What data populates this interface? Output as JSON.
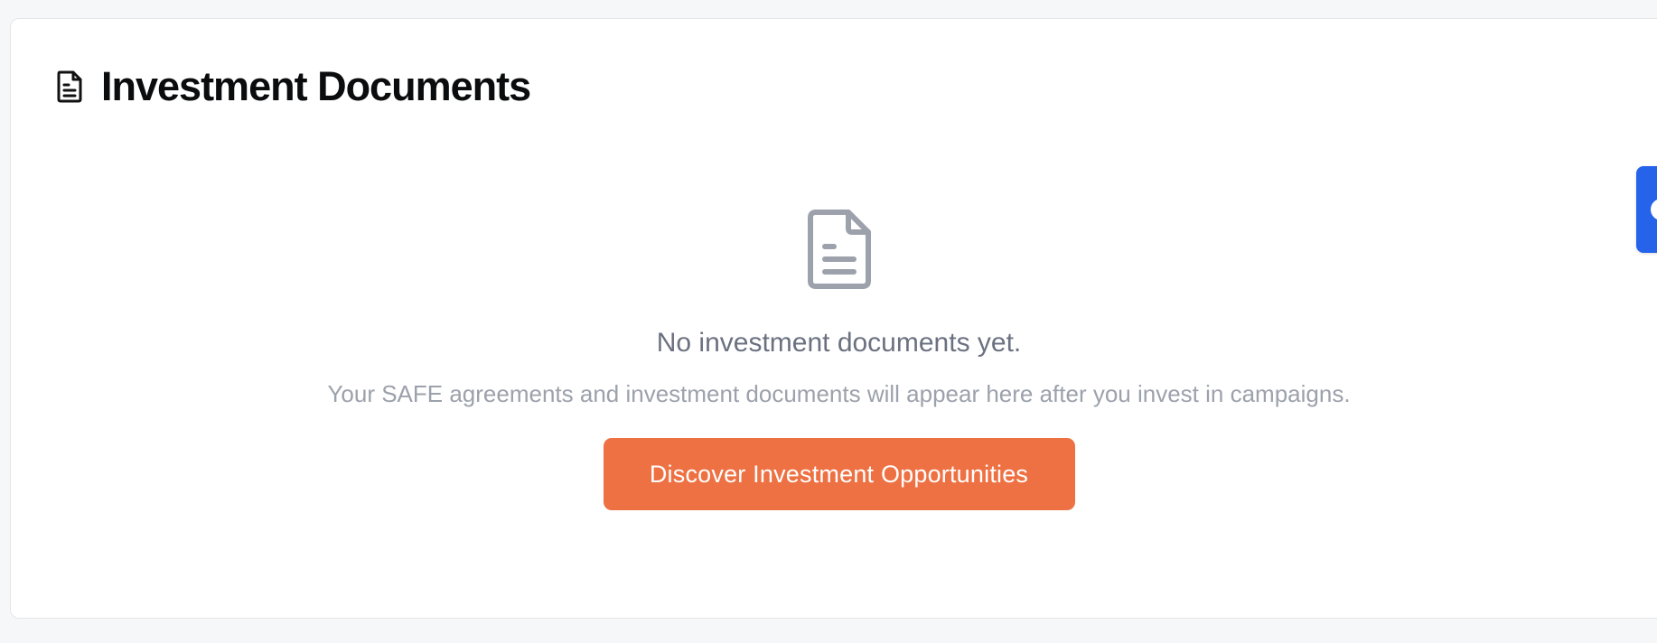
{
  "header": {
    "icon": "document-icon",
    "title": "Investment Documents"
  },
  "empty_state": {
    "icon": "document-icon",
    "title": "No investment documents yet.",
    "description": "Your SAFE agreements and investment documents will appear here after you invest in campaigns.",
    "cta_label": "Discover Investment Opportunities"
  },
  "side_tab": {
    "icon": "circle-icon"
  },
  "colors": {
    "cta": "#ee7143",
    "title_text": "#0b0c0e",
    "muted_text": "#6b7180",
    "light_text": "#9ca1ab",
    "icon_gray": "#9ca1ab",
    "side_tab": "#2563eb"
  }
}
